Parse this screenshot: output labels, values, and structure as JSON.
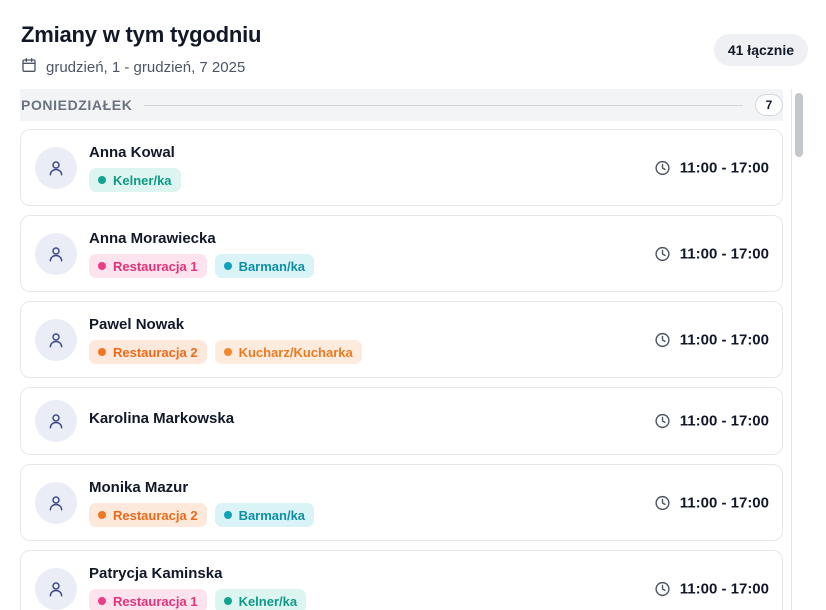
{
  "header": {
    "title": "Zmiany w tym tygodniu",
    "date_range": "grudzień, 1 - grudzień, 7 2025",
    "total": "41 łącznie"
  },
  "day": {
    "label": "PONIEDZIAŁEK",
    "count": "7"
  },
  "tag_styles": {
    "Kelner/ka": {
      "bg": "#dcf5f0",
      "fg": "#0f9a86",
      "dot": "#11a58f"
    },
    "Barman/ka": {
      "bg": "#d9f3f7",
      "fg": "#0e8fa5",
      "dot": "#0fa3bb"
    },
    "Restauracja 1": {
      "bg": "#fde3ee",
      "fg": "#e0337a",
      "dot": "#ec3c86"
    },
    "Restauracja 2": {
      "bg": "#fde9dc",
      "fg": "#ea6a1a",
      "dot": "#f07624"
    },
    "Kucharz/Kucharka": {
      "bg": "#fdecde",
      "fg": "#ea7a22",
      "dot": "#f2872c"
    }
  },
  "shifts": [
    {
      "name": "Anna Kowal",
      "tags": [
        "Kelner/ka"
      ],
      "time": "11:00 - 17:00"
    },
    {
      "name": "Anna Morawiecka",
      "tags": [
        "Restauracja 1",
        "Barman/ka"
      ],
      "time": "11:00 - 17:00"
    },
    {
      "name": "Pawel Nowak",
      "tags": [
        "Restauracja 2",
        "Kucharz/Kucharka"
      ],
      "time": "11:00 - 17:00"
    },
    {
      "name": "Karolina Markowska",
      "tags": [],
      "time": "11:00 - 17:00"
    },
    {
      "name": "Monika Mazur",
      "tags": [
        "Restauracja 2",
        "Barman/ka"
      ],
      "time": "11:00 - 17:00"
    },
    {
      "name": "Patrycja Kaminska",
      "tags": [
        "Restauracja 1",
        "Kelner/ka"
      ],
      "time": "11:00 - 17:00"
    }
  ],
  "icons": {
    "date": "calendar-icon",
    "avatar": "user-icon",
    "time": "clock-icon"
  }
}
